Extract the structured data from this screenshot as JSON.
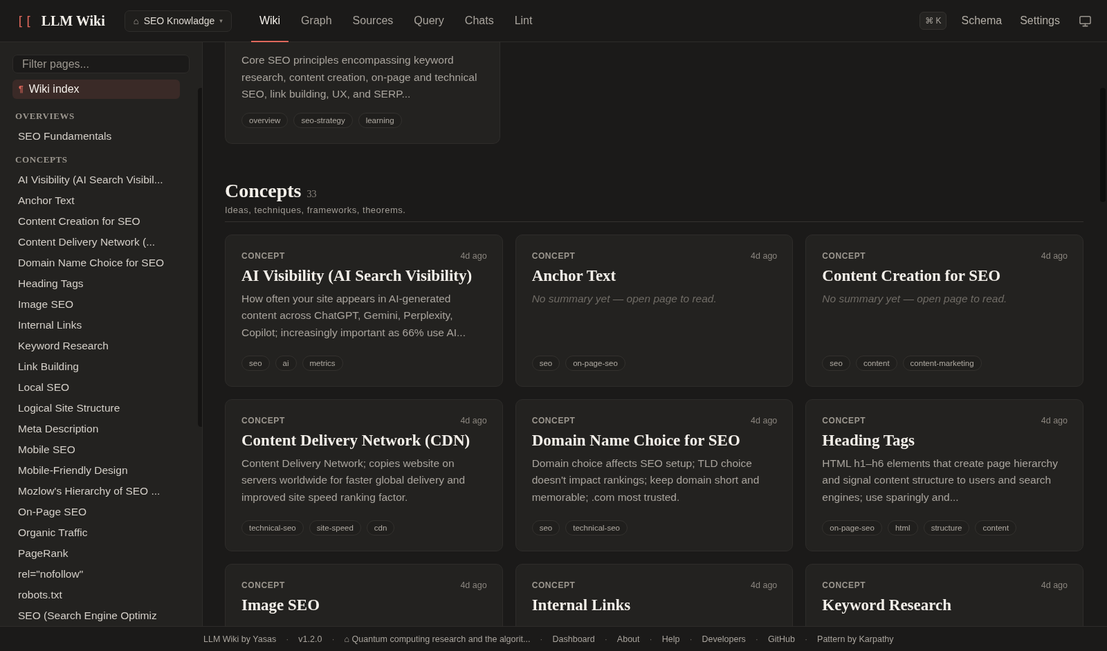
{
  "header": {
    "logo_mark": "[[",
    "brand": "LLM Wiki",
    "workspace": {
      "icon": "⌂",
      "label": "SEO Knowladge",
      "caret": "▾"
    },
    "tabs": [
      {
        "label": "Wiki",
        "selected": true
      },
      {
        "label": "Graph",
        "selected": false
      },
      {
        "label": "Sources",
        "selected": false
      },
      {
        "label": "Query",
        "selected": false
      },
      {
        "label": "Chats",
        "selected": false
      },
      {
        "label": "Lint",
        "selected": false
      }
    ],
    "shortcut": "⌘ K",
    "links": [
      "Schema",
      "Settings"
    ]
  },
  "sidebar": {
    "filter": {
      "placeholder": "Filter pages..."
    },
    "index_item": {
      "icon": "¶",
      "label": "Wiki index",
      "selected": true
    },
    "groups": [
      {
        "heading": "OVERVIEWS",
        "items": [
          "SEO Fundamentals"
        ]
      },
      {
        "heading": "CONCEPTS",
        "items": [
          "AI Visibility (AI Search Visibil...",
          "Anchor Text",
          "Content Creation for SEO",
          "Content Delivery Network (...",
          "Domain Name Choice for SEO",
          "Heading Tags",
          "Image SEO",
          "Internal Links",
          "Keyword Research",
          "Link Building",
          "Local SEO",
          "Logical Site Structure",
          "Meta Description",
          "Mobile SEO",
          "Mobile-Friendly Design",
          "Mozlow's Hierarchy of SEO ...",
          "On-Page SEO",
          "Organic Traffic",
          "PageRank",
          "rel=\"nofollow\"",
          "robots.txt",
          "SEO (Search Engine Optimiz"
        ]
      }
    ]
  },
  "top_card": {
    "summary": "Core SEO principles encompassing keyword research, content creation, on-page and technical SEO, link building, UX, and SERP...",
    "tags": [
      "overview",
      "seo-strategy",
      "learning"
    ]
  },
  "section": {
    "title": "Concepts",
    "count": "33",
    "subtitle": "Ideas, techniques, frameworks, theorems.",
    "cards": [
      {
        "kind_label": "CONCEPT",
        "age": "4d ago",
        "title": "AI Visibility (AI Search Visibility)",
        "summary": {
          "kind": "text",
          "text": "How often your site appears in AI-generated content across ChatGPT, Gemini, Perplexity, Copilot; increasingly important as 66% use AI..."
        },
        "tags": [
          "seo",
          "ai",
          "metrics"
        ]
      },
      {
        "kind_label": "CONCEPT",
        "age": "4d ago",
        "title": "Anchor Text",
        "summary": {
          "kind": "placeholder",
          "text": "No summary yet — open page to read."
        },
        "tags": [
          "seo",
          "on-page-seo"
        ]
      },
      {
        "kind_label": "CONCEPT",
        "age": "4d ago",
        "title": "Content Creation for SEO",
        "summary": {
          "kind": "placeholder",
          "text": "No summary yet — open page to read."
        },
        "tags": [
          "seo",
          "content",
          "content-marketing"
        ]
      },
      {
        "kind_label": "CONCEPT",
        "age": "4d ago",
        "title": "Content Delivery Network (CDN)",
        "summary": {
          "kind": "text",
          "text": "Content Delivery Network; copies website on servers worldwide for faster global delivery and improved site speed ranking factor."
        },
        "tags": [
          "technical-seo",
          "site-speed",
          "cdn"
        ]
      },
      {
        "kind_label": "CONCEPT",
        "age": "4d ago",
        "title": "Domain Name Choice for SEO",
        "summary": {
          "kind": "text",
          "text": "Domain choice affects SEO setup; TLD choice doesn't impact rankings; keep domain short and memorable; .com most trusted."
        },
        "tags": [
          "seo",
          "technical-seo"
        ]
      },
      {
        "kind_label": "CONCEPT",
        "age": "4d ago",
        "title": "Heading Tags",
        "summary": {
          "kind": "text",
          "text": "HTML h1–h6 elements that create page hierarchy and signal content structure to users and search engines; use sparingly and..."
        },
        "tags": [
          "on-page-seo",
          "html",
          "structure",
          "content"
        ]
      },
      {
        "kind_label": "CONCEPT",
        "age": "4d ago",
        "title": "Image SEO"
      },
      {
        "kind_label": "CONCEPT",
        "age": "4d ago",
        "title": "Internal Links"
      },
      {
        "kind_label": "CONCEPT",
        "age": "4d ago",
        "title": "Keyword Research"
      }
    ]
  },
  "footer": {
    "separator": "·",
    "items": [
      "LLM Wiki by Yasas",
      "v1.2.0",
      "⌂ Quantum computing research and the algorit...",
      "Dashboard",
      "About",
      "Help",
      "Developers",
      "GitHub",
      "Pattern by Karpathy"
    ]
  }
}
